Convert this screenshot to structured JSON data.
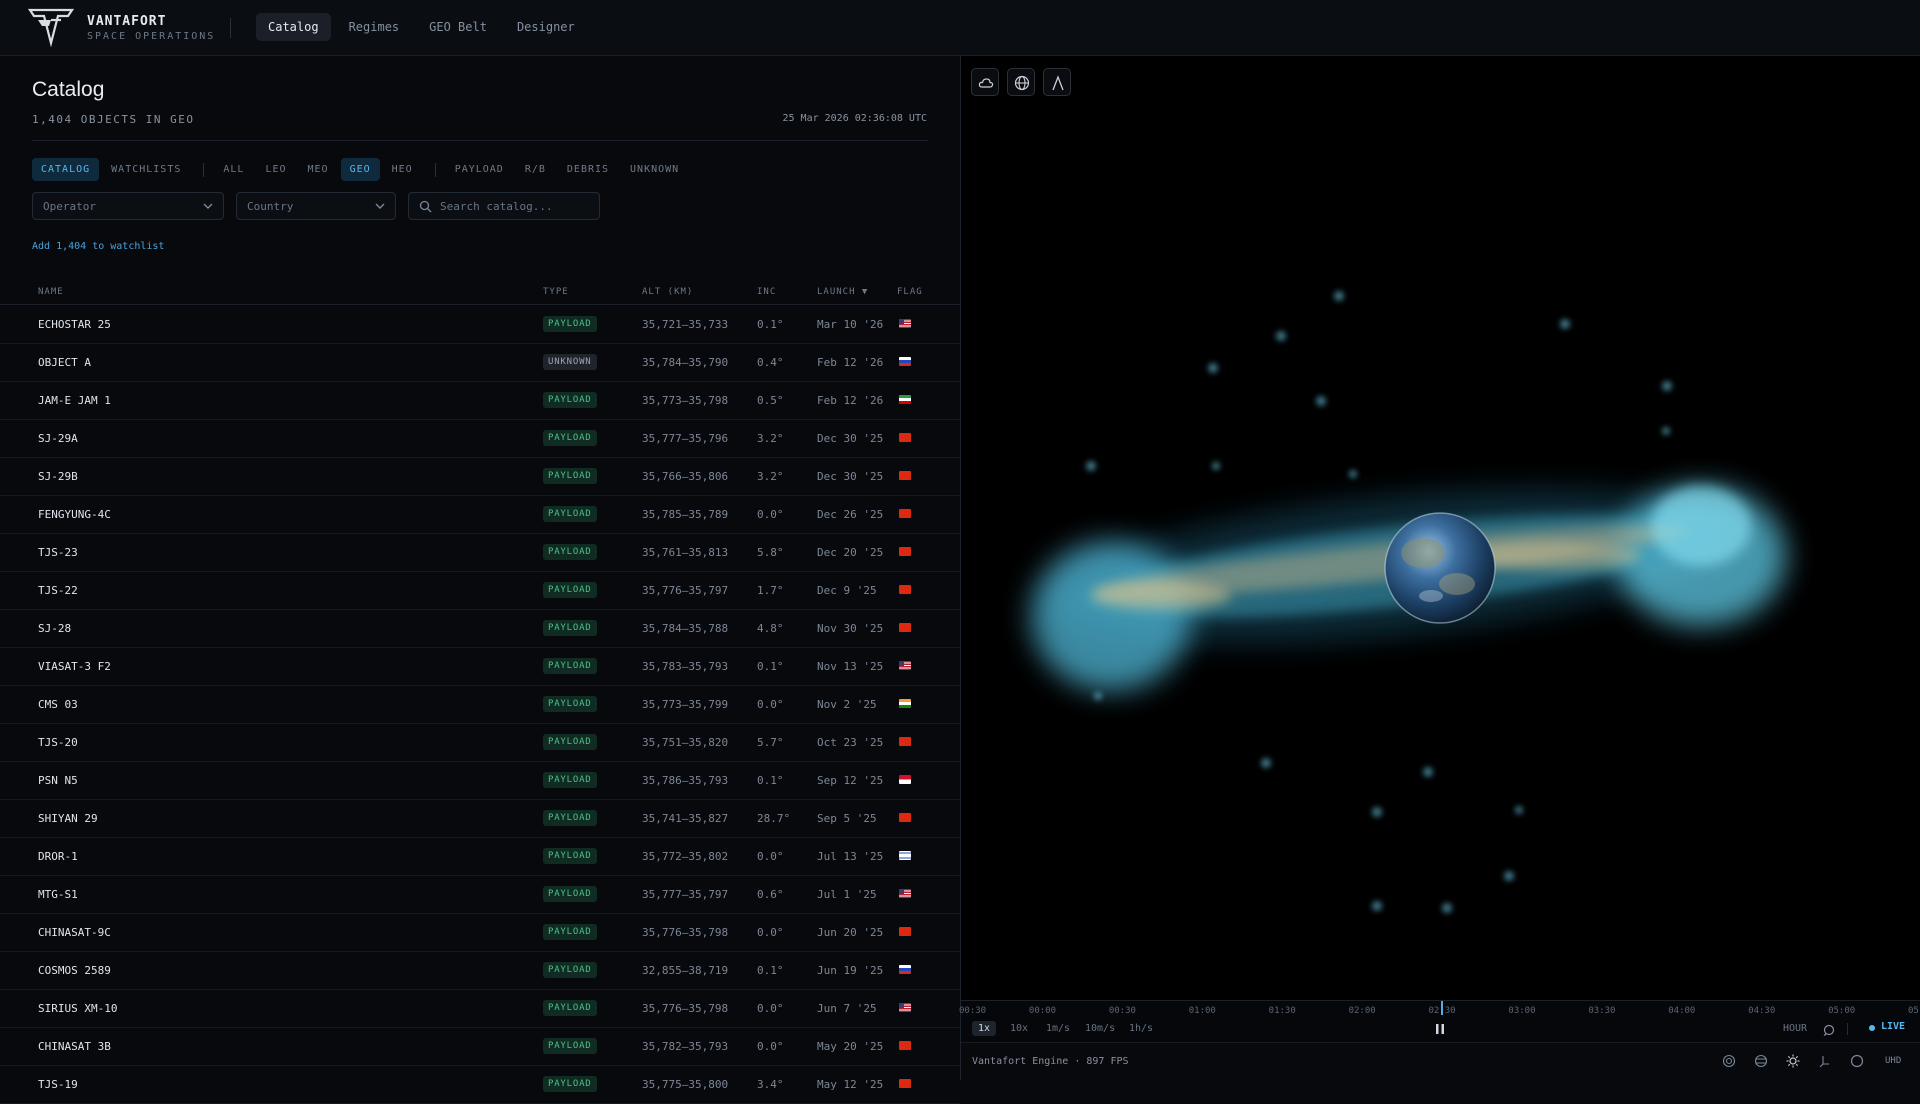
{
  "brand": {
    "name": "VANTAFORT",
    "tagline": "SPACE OPERATIONS"
  },
  "nav": {
    "tabs": [
      "Catalog",
      "Regimes",
      "GEO Belt",
      "Designer"
    ],
    "active": "Catalog"
  },
  "catalog": {
    "title": "Catalog",
    "subtitle": "1,404 OBJECTS IN GEO",
    "datetime": "25 Mar 2026 02:36:08 UTC",
    "view_tabs": [
      "CATALOG",
      "WATCHLISTS"
    ],
    "regimes": [
      "ALL",
      "LEO",
      "MEO",
      "GEO",
      "HEO"
    ],
    "types": [
      "PAYLOAD",
      "R/B",
      "DEBRIS",
      "UNKNOWN"
    ],
    "active_view": "CATALOG",
    "active_regime": "GEO",
    "operator_placeholder": "Operator",
    "country_placeholder": "Country",
    "search_placeholder": "Search catalog...",
    "add_watchlist": "Add 1,404 to watchlist",
    "columns": {
      "name": "NAME",
      "type": "TYPE",
      "alt": "ALT (KM)",
      "inc": "INC",
      "launch": "LAUNCH ▼",
      "flag": "FLAG"
    },
    "rows": [
      {
        "name": "ECHOSTAR 25",
        "type": "PAYLOAD",
        "alt": "35,721–35,733",
        "inc": "0.1°",
        "launch": "Mar 10 '26",
        "flag": "US"
      },
      {
        "name": "OBJECT A",
        "type": "UNKNOWN",
        "alt": "35,784–35,790",
        "inc": "0.4°",
        "launch": "Feb 12 '26",
        "flag": "RU"
      },
      {
        "name": "JAM-E JAM 1",
        "type": "PAYLOAD",
        "alt": "35,773–35,798",
        "inc": "0.5°",
        "launch": "Feb 12 '26",
        "flag": "IR"
      },
      {
        "name": "SJ-29A",
        "type": "PAYLOAD",
        "alt": "35,777–35,796",
        "inc": "3.2°",
        "launch": "Dec 30 '25",
        "flag": "CN"
      },
      {
        "name": "SJ-29B",
        "type": "PAYLOAD",
        "alt": "35,766–35,806",
        "inc": "3.2°",
        "launch": "Dec 30 '25",
        "flag": "CN"
      },
      {
        "name": "FENGYUNG-4C",
        "type": "PAYLOAD",
        "alt": "35,785–35,789",
        "inc": "0.0°",
        "launch": "Dec 26 '25",
        "flag": "CN"
      },
      {
        "name": "TJS-23",
        "type": "PAYLOAD",
        "alt": "35,761–35,813",
        "inc": "5.8°",
        "launch": "Dec 20 '25",
        "flag": "CN"
      },
      {
        "name": "TJS-22",
        "type": "PAYLOAD",
        "alt": "35,776–35,797",
        "inc": "1.7°",
        "launch": "Dec 9 '25",
        "flag": "CN"
      },
      {
        "name": "SJ-28",
        "type": "PAYLOAD",
        "alt": "35,784–35,788",
        "inc": "4.8°",
        "launch": "Nov 30 '25",
        "flag": "CN"
      },
      {
        "name": "VIASAT-3 F2",
        "type": "PAYLOAD",
        "alt": "35,783–35,793",
        "inc": "0.1°",
        "launch": "Nov 13 '25",
        "flag": "US"
      },
      {
        "name": "CMS 03",
        "type": "PAYLOAD",
        "alt": "35,773–35,799",
        "inc": "0.0°",
        "launch": "Nov 2 '25",
        "flag": "IN"
      },
      {
        "name": "TJS-20",
        "type": "PAYLOAD",
        "alt": "35,751–35,820",
        "inc": "5.7°",
        "launch": "Oct 23 '25",
        "flag": "CN"
      },
      {
        "name": "PSN N5",
        "type": "PAYLOAD",
        "alt": "35,786–35,793",
        "inc": "0.1°",
        "launch": "Sep 12 '25",
        "flag": "ID"
      },
      {
        "name": "SHIYAN 29",
        "type": "PAYLOAD",
        "alt": "35,741–35,827",
        "inc": "28.7°",
        "launch": "Sep 5 '25",
        "flag": "CN"
      },
      {
        "name": "DROR-1",
        "type": "PAYLOAD",
        "alt": "35,772–35,802",
        "inc": "0.0°",
        "launch": "Jul 13 '25",
        "flag": "IL"
      },
      {
        "name": "MTG-S1",
        "type": "PAYLOAD",
        "alt": "35,777–35,797",
        "inc": "0.6°",
        "launch": "Jul 1 '25",
        "flag": "US"
      },
      {
        "name": "CHINASAT-9C",
        "type": "PAYLOAD",
        "alt": "35,776–35,798",
        "inc": "0.0°",
        "launch": "Jun 20 '25",
        "flag": "CN"
      },
      {
        "name": "COSMOS 2589",
        "type": "PAYLOAD",
        "alt": "32,855–38,719",
        "inc": "0.1°",
        "launch": "Jun 19 '25",
        "flag": "RU"
      },
      {
        "name": "SIRIUS XM-10",
        "type": "PAYLOAD",
        "alt": "35,776–35,798",
        "inc": "0.0°",
        "launch": "Jun 7 '25",
        "flag": "US"
      },
      {
        "name": "CHINASAT 3B",
        "type": "PAYLOAD",
        "alt": "35,782–35,793",
        "inc": "0.0°",
        "launch": "May 20 '25",
        "flag": "CN"
      },
      {
        "name": "TJS-19",
        "type": "PAYLOAD",
        "alt": "35,775–35,800",
        "inc": "3.4°",
        "launch": "May 12 '25",
        "flag": "CN"
      }
    ]
  },
  "viewer": {
    "toolbar_icons": [
      "cloud-icon",
      "globe-icon",
      "lambda-icon"
    ],
    "timeline": {
      "labels": [
        "00:30",
        "00:00",
        "00:30",
        "01:00",
        "01:30",
        "02:00",
        "02:30",
        "03:00",
        "03:30",
        "04:00",
        "04:30",
        "05:00",
        "05:"
      ],
      "speeds": [
        "1x",
        "10x",
        "1m/s",
        "10m/s",
        "1h/s"
      ],
      "active_speed": "1x",
      "range": "HOUR",
      "live": "LIVE",
      "playhead_fraction": 0.5
    },
    "status": {
      "engine": "Vantafort Engine · 897 FPS",
      "quality": "UHD"
    },
    "colors": {
      "accent": "#58b7ee",
      "payload": "#4cc08a",
      "belt": "#6fd6f2"
    }
  }
}
